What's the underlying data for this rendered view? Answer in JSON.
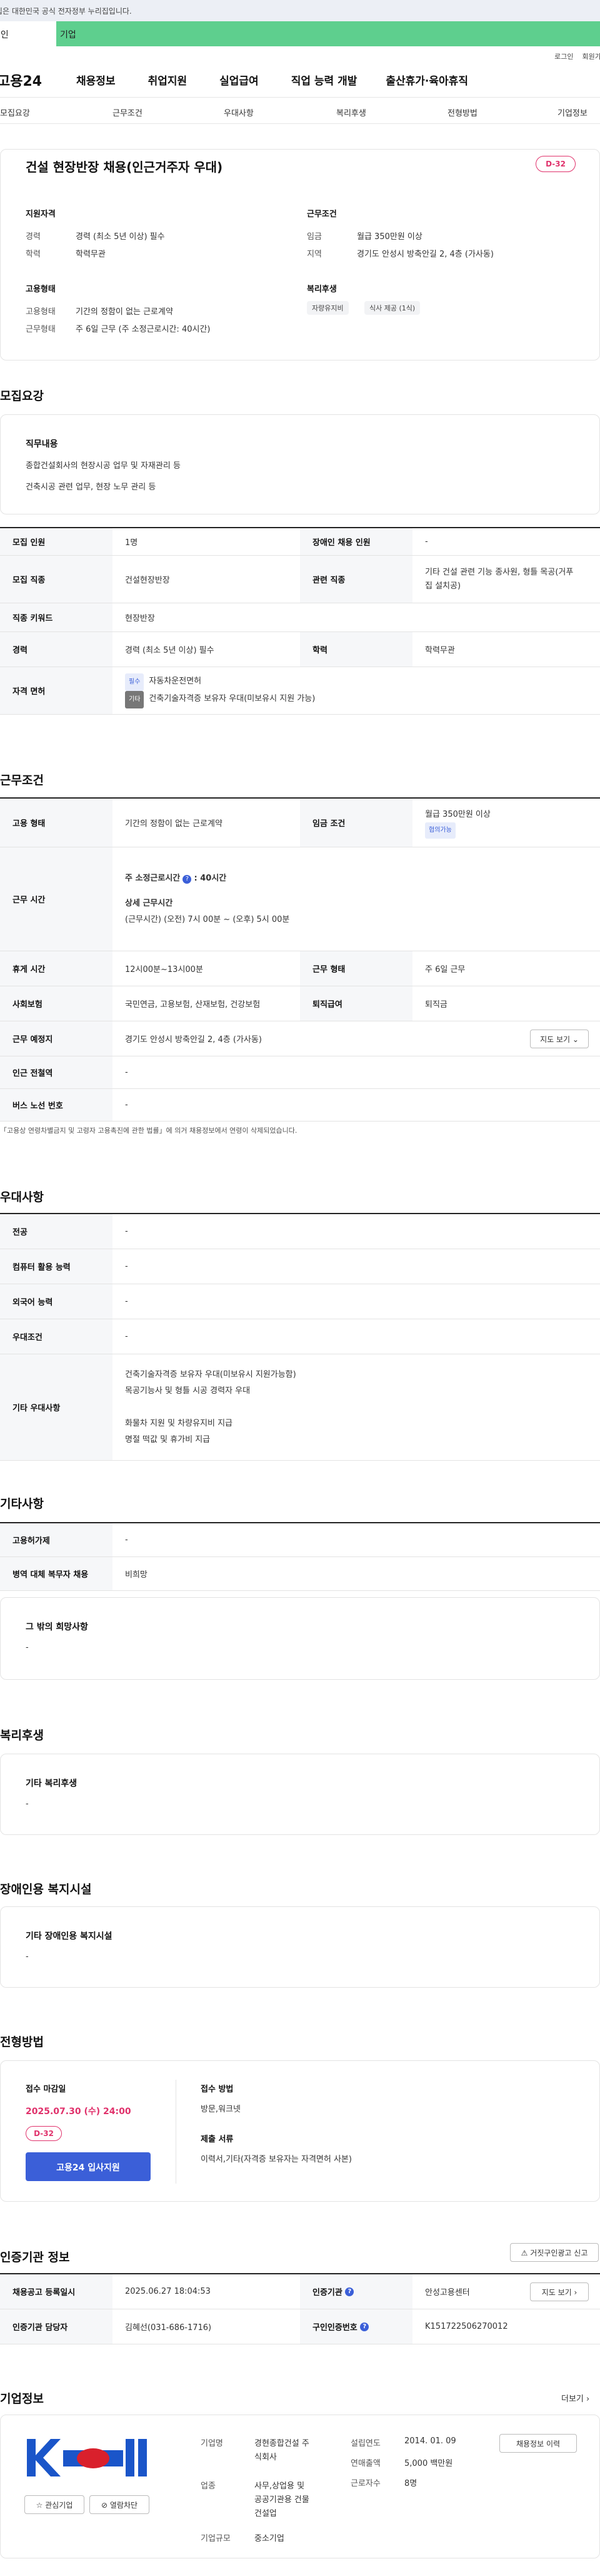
{
  "banner": {
    "text": "이 누리집은 대한민국 공식 전자정부 누리집입니다."
  },
  "site_tabs": {
    "individual": "개인",
    "company": "기업"
  },
  "util_links": {
    "login": "로그인",
    "signup": "회원가입"
  },
  "gnb": {
    "logo": "고용24",
    "items": [
      "채용정보",
      "취업지원",
      "실업급여",
      "직업 능력 개발",
      "출산휴가·육아휴직"
    ]
  },
  "anchors": [
    "모집요강",
    "근무조건",
    "우대사항",
    "복리후생",
    "전형방법",
    "기업정보"
  ],
  "summary": {
    "title": "건설 현장반장 채용(인근거주자 우대)",
    "dday": "D-32",
    "qual_label": "지원자격",
    "career_k": "경력",
    "career_v": "경력 (최소 5년 이상) 필수",
    "edu_k": "학력",
    "edu_v": "학력무관",
    "cond_label": "근무조건",
    "wage_k": "임금",
    "wage_v": "월급 350만원 이상",
    "region_k": "지역",
    "region_v": "경기도 안성시 방축안길 2, 4층 (가사동)",
    "emp_label": "고용형태",
    "emptype_k": "고용형태",
    "emptype_v": "기간의 정함이 없는 근로계약",
    "workform_k": "근무형태",
    "workform_v": "주 6일 근무 (주 소정근로시간: 40시간)",
    "welfare_label": "복리후생",
    "welfare_chips": [
      "자량유지비",
      "식사 제공 (1식)"
    ]
  },
  "recruit": {
    "section_title": "모집요강",
    "duty_label": "직무내용",
    "duty_lines": [
      "종합건설회사의 현장시공 업무 및 자재관리 등",
      "건축시공 관련 업무, 현장 노무 관리 등"
    ],
    "rows": {
      "count_k": "모집 인원",
      "count_v": "1명",
      "disabled_k": "장애인 채용 인원",
      "disabled_v": "-",
      "job_k": "모집 직종",
      "job_v": "건설현장반장",
      "related_k": "관련 직종",
      "related_v1": "기타 건설 관련 기능 종사원, 형틀 목공(거푸",
      "related_v2": "집 설치공)",
      "keyword_k": "직종 키워드",
      "keyword_v": "현장반장",
      "career_k": "경력",
      "career_v": "경력 (최소 5년 이상) 필수",
      "edu_k": "학력",
      "edu_v": "학력무관",
      "license_k": "자격 면허",
      "license_req_tag": "필수",
      "license_req": "자동차운전면허",
      "license_pref_tag": "기타",
      "license_pref": "건축기술자격증 보유자 우대(미보유시 지원 가능)"
    }
  },
  "conditions": {
    "section_title": "근무조건",
    "emptype_k": "고용 형태",
    "emptype_v": "기간의 정함이 없는 근로계약",
    "wage_k": "임금 조건",
    "wage_v": "월급 350만원 이상",
    "wage_tag": "협의가능",
    "hours_k": "근무 시간",
    "hours_total": "주 소정근로시간",
    "hours_total_v": ": 40시간",
    "hours_detail_label": "상세 근무시간",
    "hours_detail": "(근무시간) (오전) 7시 00분 ~ (오후) 5시 00분",
    "break_k": "휴게 시간",
    "break_v": "12시00분~13시00분",
    "form_k": "근무 형태",
    "form_v": "주 6일 근무",
    "insurance_k": "사회보험",
    "insurance_v": "국민연금, 고용보험, 산재보험, 건강보험",
    "retire_k": "퇴직급여",
    "retire_v": "퇴직금",
    "place_k": "근무 예정지",
    "place_v": "경기도 안성시 방축안길 2, 4층 (가사동)",
    "map_btn": "지도 보기",
    "station_k": "인근 전철역",
    "station_v": "-",
    "bus_k": "버스 노선 번호",
    "bus_v": "-",
    "note": "「고용상 연령차별금지 및 고령자 고용촉진에 관한 법률」에 의거 채용정보에서 연령이 삭제되었습니다."
  },
  "preference": {
    "section_title": "우대사항",
    "major_k": "전공",
    "major_v": "-",
    "computer_k": "컴퓨터 활용 능력",
    "computer_v": "-",
    "lang_k": "외국어 능력",
    "lang_v": "-",
    "cond_k": "우대조건",
    "cond_v": "-",
    "etc_k": "기타 우대사항",
    "etc_lines": [
      "건축기술자격증 보유자 우대(미보유시 지원가능함)",
      "목공기능사 및 형틀 시공 경력자 우대",
      "",
      "화물차 지원 및 차량유지비 지급",
      "명절 떡값 및 휴가비 지급"
    ]
  },
  "others": {
    "section_title": "기타사항",
    "subsidy_k": "고용허가제",
    "subsidy_v": "-",
    "military_k": "병역 대체 복무자 채용",
    "military_v": "비희망",
    "wish_title": "그 밖의 희망사항",
    "wish_v": "-"
  },
  "welfare": {
    "section_title": "복리후생",
    "title": "기타 복리후생",
    "value": "-"
  },
  "disability": {
    "section_title": "장애인용 복지시설",
    "title": "기타 장애인용 복지시설",
    "value": "-"
  },
  "selection": {
    "section_title": "전형방법",
    "deadline_label": "접수 마감일",
    "deadline": "2025.07.30 (수) 24:00",
    "dday": "D-32",
    "apply_btn": "고용24 입사지원",
    "method_label": "접수 방법",
    "method_v": "방문,워크넷",
    "docs_label": "제출 서류",
    "docs_v": "이력서,기타(자격증 보유자는 자격면허 사본)"
  },
  "agency": {
    "section_title": "인증기관 정보",
    "report_btn": "거짓구인광고 신고",
    "reg_k": "채용공고 등록일시",
    "reg_v": "2025.06.27 18:04:53",
    "org_k": "인증기관",
    "org_v": "안성고용센터",
    "map_btn": "지도 보기",
    "manager_k": "인증기관 담당자",
    "manager_v": "김혜선(031-686-1716)",
    "id_k": "구인인증번호",
    "id_v": "K151722506270012"
  },
  "company": {
    "section_title": "기업정보",
    "more": "더보기",
    "fav_btn": "관심기업",
    "block_btn": "열람차단",
    "name_k": "기업명",
    "name_v1": "경현종합건설 주",
    "name_v2": "식회사",
    "industry_k": "업종",
    "industry_v1": "사무,상업용 및",
    "industry_v2": "공공기관용 건물",
    "industry_v3": "건설업",
    "size_k": "기업규모",
    "size_v": "중소기업",
    "est_k": "설립연도",
    "est_v": "2014. 01. 09",
    "sales_k": "연매출액",
    "sales_v": "5,000 백만원",
    "emp_k": "근로자수",
    "emp_v": "8명",
    "list_btn": "채용정보 이력",
    "colors": {
      "blue": "#1a55c9",
      "red": "#d9202c"
    }
  }
}
